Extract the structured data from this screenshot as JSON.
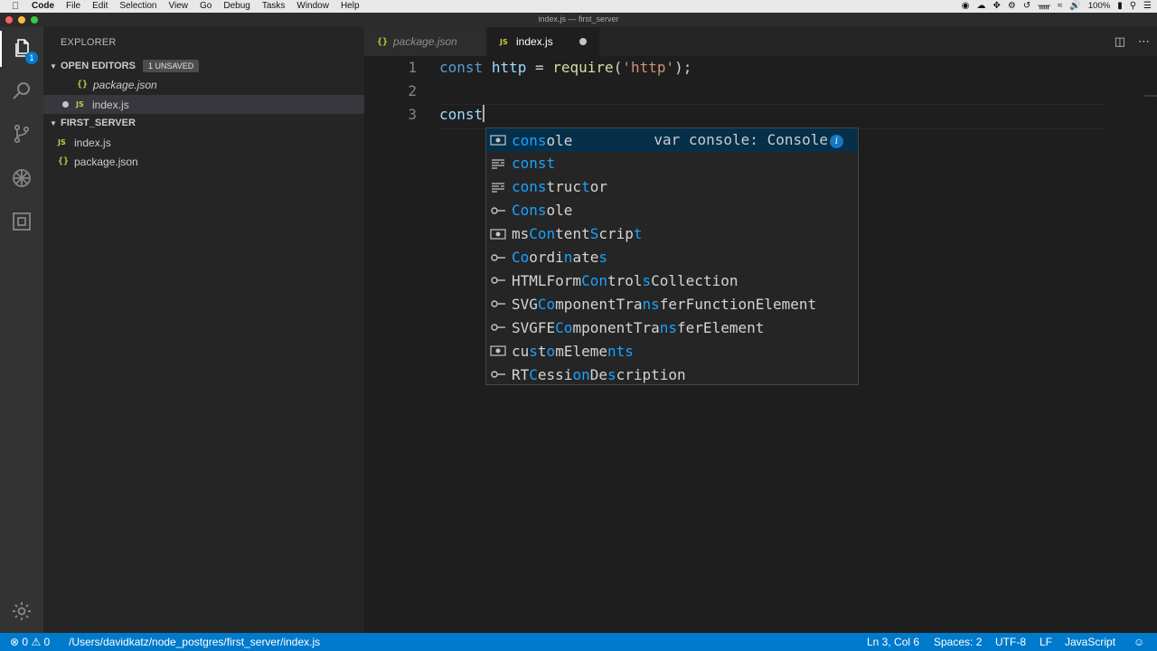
{
  "menubar": {
    "app": "Code",
    "items": [
      "File",
      "Edit",
      "Selection",
      "View",
      "Go",
      "Debug",
      "Tasks",
      "Window",
      "Help"
    ],
    "battery": "100%"
  },
  "window": {
    "title": "index.js — first_server"
  },
  "activity": {
    "explorer_badge": "1"
  },
  "sidebar": {
    "header": "EXPLORER",
    "open_editors": {
      "label": "OPEN EDITORS",
      "badge": "1 UNSAVED",
      "items": [
        {
          "icon": "{}",
          "name": "package.json"
        },
        {
          "icon": "JS",
          "name": "index.js"
        }
      ]
    },
    "folder": {
      "label": "FIRST_SERVER",
      "items": [
        {
          "icon": "JS",
          "name": "index.js"
        },
        {
          "icon": "{}",
          "name": "package.json"
        }
      ]
    }
  },
  "tabs": [
    {
      "icon": "{}",
      "label": "package.json",
      "active": false
    },
    {
      "icon": "JS",
      "label": "index.js",
      "active": true,
      "dirty": true
    }
  ],
  "editor": {
    "lines": [
      {
        "number": "1",
        "tokens": [
          [
            "kw",
            "const"
          ],
          [
            "punc",
            " "
          ],
          [
            "var",
            "http"
          ],
          [
            "punc",
            " = "
          ],
          [
            "fn",
            "require"
          ],
          [
            "punc",
            "("
          ],
          [
            "str",
            "'http'"
          ],
          [
            "punc",
            ");"
          ]
        ]
      },
      {
        "number": "2",
        "tokens": []
      },
      {
        "number": "3",
        "tokens": [
          [
            "var",
            "const"
          ]
        ]
      }
    ]
  },
  "suggest": {
    "items": [
      {
        "kind": "variable",
        "segments": [
          [
            "h",
            "cons"
          ],
          [
            "n",
            "ole"
          ]
        ],
        "detail": "var console: Console"
      },
      {
        "kind": "keyword",
        "segments": [
          [
            "h",
            "const"
          ]
        ]
      },
      {
        "kind": "keyword",
        "segments": [
          [
            "h",
            "cons"
          ],
          [
            "n",
            "truc"
          ],
          [
            "h",
            "t"
          ],
          [
            "n",
            "or"
          ]
        ]
      },
      {
        "kind": "interface",
        "segments": [
          [
            "h",
            "Cons"
          ],
          [
            "n",
            "ole"
          ]
        ]
      },
      {
        "kind": "variable",
        "segments": [
          [
            "n",
            "ms"
          ],
          [
            "h",
            "Con"
          ],
          [
            "n",
            "tent"
          ],
          [
            "h",
            "S"
          ],
          [
            "n",
            "crip"
          ],
          [
            "h",
            "t"
          ]
        ]
      },
      {
        "kind": "interface",
        "segments": [
          [
            "h",
            "Co"
          ],
          [
            "n",
            "ordi"
          ],
          [
            "h",
            "n"
          ],
          [
            "n",
            "ate"
          ],
          [
            "h",
            "s"
          ]
        ]
      },
      {
        "kind": "interface",
        "segments": [
          [
            "n",
            "HTMLForm"
          ],
          [
            "h",
            "Con"
          ],
          [
            "n",
            "trol"
          ],
          [
            "h",
            "s"
          ],
          [
            "n",
            "Collection"
          ]
        ]
      },
      {
        "kind": "interface",
        "segments": [
          [
            "n",
            "SVG"
          ],
          [
            "h",
            "Co"
          ],
          [
            "n",
            "mponentTra"
          ],
          [
            "h",
            "ns"
          ],
          [
            "n",
            "ferFunctionElement"
          ]
        ]
      },
      {
        "kind": "interface",
        "segments": [
          [
            "n",
            "SVGFE"
          ],
          [
            "h",
            "Co"
          ],
          [
            "n",
            "mponentTra"
          ],
          [
            "h",
            "ns"
          ],
          [
            "n",
            "ferElement"
          ]
        ]
      },
      {
        "kind": "variable",
        "segments": [
          [
            "n",
            "cu"
          ],
          [
            "h",
            "s"
          ],
          [
            "n",
            "t"
          ],
          [
            "h",
            "o"
          ],
          [
            "n",
            "mEleme"
          ],
          [
            "h",
            "nts"
          ]
        ]
      },
      {
        "kind": "interface",
        "segments": [
          [
            "n",
            "RT"
          ],
          [
            "h",
            "C"
          ],
          [
            "n",
            "essi"
          ],
          [
            "h",
            "on"
          ],
          [
            "n",
            "De"
          ],
          [
            "h",
            "s"
          ],
          [
            "n",
            "cription"
          ]
        ]
      }
    ]
  },
  "statusbar": {
    "errors": "0",
    "warnings": "0",
    "path": "/Users/davidkatz/node_postgres/first_server/index.js",
    "position": "Ln 3, Col 6",
    "spaces": "Spaces: 2",
    "encoding": "UTF-8",
    "eol": "LF",
    "language": "JavaScript"
  },
  "colors": {
    "accent": "#007acc",
    "highlight": "#18a3ff",
    "focused_row": "#062f4a"
  }
}
